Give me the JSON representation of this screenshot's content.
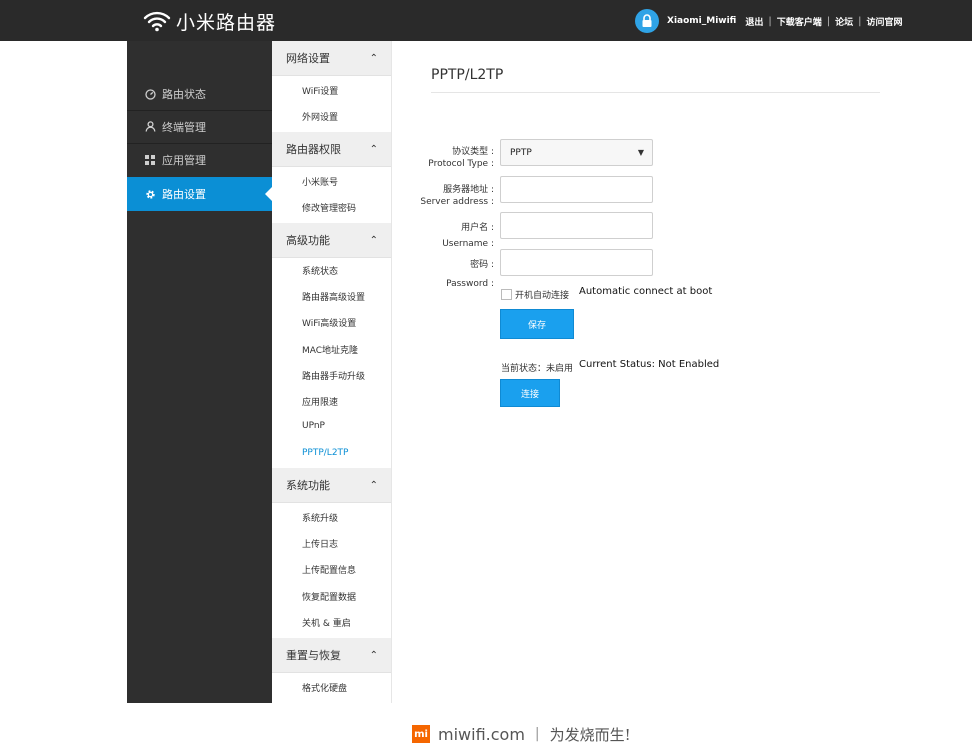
{
  "header": {
    "app_name": "小米路由器",
    "user": "Xiaomi_Miwifi",
    "links": [
      "退出",
      "下载客户端",
      "论坛",
      "访问官网"
    ]
  },
  "sidebar": {
    "items": [
      {
        "label": "路由状态",
        "icon": "gauge-icon"
      },
      {
        "label": "终端管理",
        "icon": "person-icon"
      },
      {
        "label": "应用管理",
        "icon": "apps-grid-icon"
      },
      {
        "label": "路由设置",
        "icon": "gear-icon",
        "active": true
      }
    ]
  },
  "subnav": {
    "groups": [
      {
        "title": "网络设置",
        "items": [
          "WiFi设置",
          "外网设置"
        ]
      },
      {
        "title": "路由器权限",
        "items": [
          "小米账号",
          "修改管理密码"
        ]
      },
      {
        "title": "高级功能",
        "items": [
          "系统状态",
          "路由器高级设置",
          "WiFi高级设置",
          "MAC地址克隆",
          "路由器手动升级",
          "应用限速",
          "UPnP",
          "PPTP/L2TP"
        ]
      },
      {
        "title": "系统功能",
        "items": [
          "系统升级",
          "上传日志",
          "上传配置信息",
          "恢复配置数据",
          "关机 & 重启"
        ]
      },
      {
        "title": "重置与恢复",
        "items": [
          "格式化硬盘"
        ]
      }
    ],
    "active_item": "PPTP/L2TP"
  },
  "main": {
    "title": "PPTP/L2TP",
    "protocol": {
      "label_cn": "协议类型 :",
      "label_en": "Protocol Type :",
      "value": "PPTP"
    },
    "server": {
      "label_cn": "服务器地址 :",
      "label_en": "Server address :",
      "value": ""
    },
    "username": {
      "label_cn": "用户名 :",
      "label_en": "Username :",
      "value": ""
    },
    "password": {
      "label_cn": "密码 :",
      "label_en": "Password :",
      "value": ""
    },
    "autoconnect": {
      "label_cn": "开机自动连接",
      "label_en": "Automatic connect at boot",
      "checked": false
    },
    "save_label": "保存",
    "status_cn": "当前状态：未启用",
    "status_en": "Current Status: Not Enabled",
    "connect_label": "连接"
  },
  "footer": {
    "mi_mark": "mi",
    "domain": "miwifi.com",
    "separator": "|",
    "slogan": "为发烧而生!"
  },
  "colors": {
    "header_bg": "#2a2a2a",
    "sidebar_bg": "#2f2f2f",
    "accent": "#0b8fd5",
    "button": "#1aa0ee",
    "mi_orange": "#f56600"
  }
}
